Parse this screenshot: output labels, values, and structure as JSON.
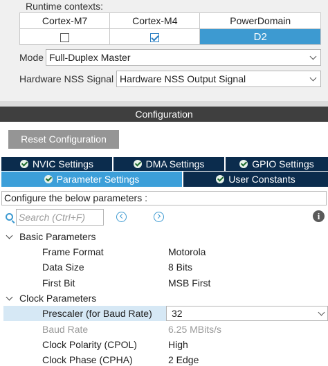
{
  "runtime": {
    "label": "Runtime contexts:",
    "headers": [
      "Cortex-M7",
      "Cortex-M4",
      "PowerDomain"
    ],
    "m7_checked": false,
    "m4_checked": true,
    "power_domain": "D2"
  },
  "mode": {
    "label": "Mode",
    "value": "Full-Duplex Master"
  },
  "nss": {
    "label": "Hardware NSS Signal",
    "value": "Hardware NSS Output Signal"
  },
  "config": {
    "title": "Configuration",
    "reset_label": "Reset Configuration",
    "tabs": [
      {
        "label": "NVIC Settings"
      },
      {
        "label": "DMA Settings"
      },
      {
        "label": "GPIO Settings"
      },
      {
        "label": "Parameter Settings"
      },
      {
        "label": "User Constants"
      }
    ],
    "description": "Configure the below parameters :",
    "search_placeholder": "Search (Ctrl+F)"
  },
  "basic": {
    "title": "Basic Parameters",
    "params": [
      {
        "name": "Frame Format",
        "value": "Motorola"
      },
      {
        "name": "Data Size",
        "value": "8 Bits"
      },
      {
        "name": "First Bit",
        "value": "MSB First"
      }
    ]
  },
  "clock": {
    "title": "Clock Parameters",
    "params": [
      {
        "name": "Prescaler (for Baud Rate)",
        "value": "32"
      },
      {
        "name": "Baud Rate",
        "value": "6.25 MBits/s"
      },
      {
        "name": "Clock Polarity (CPOL)",
        "value": "High"
      },
      {
        "name": "Clock Phase (CPHA)",
        "value": "2 Edge"
      }
    ]
  },
  "colors": {
    "accent": "#3d9ad1",
    "tab_dark": "#0b2c4d",
    "header_dark": "#3f3f3f"
  }
}
